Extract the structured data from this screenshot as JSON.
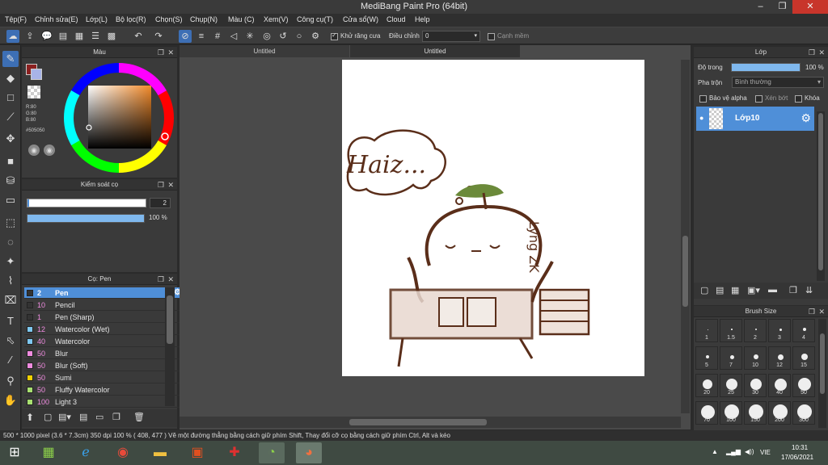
{
  "window": {
    "title": "MediBang Paint Pro (64bit)",
    "minimize": "–",
    "restore": "❐",
    "close": "✕"
  },
  "menu": [
    "Tệp(F)",
    "Chỉnh sửa(E)",
    "Lớp(L)",
    "Bộ lọc(R)",
    "Chọn(S)",
    "Chụp(N)",
    "Màu (C)",
    "Xem(V)",
    "Công cụ(T)",
    "Cửa sổ(W)",
    "Cloud",
    "Help"
  ],
  "toolbar": {
    "antialias_label": "Khử răng cưa",
    "correction_label": "Điều chỉnh",
    "correction_value": "0",
    "edge_label": "Cạnh mềm"
  },
  "color_panel": {
    "title": "Màu",
    "r": "R:80",
    "g": "G:80",
    "b": "B:80",
    "hex": "#505050",
    "accent": "#4f8fd8"
  },
  "brush_control": {
    "title": "Kiểm soát cọ",
    "size_value": "2",
    "opacity_value": "100 %"
  },
  "brush_panel": {
    "title": "Cọ: Pen",
    "items": [
      {
        "num": "2",
        "name": "Pen",
        "color": "#333333",
        "selected": true
      },
      {
        "num": "10",
        "name": "Pencil",
        "color": "#333333",
        "selected": false
      },
      {
        "num": "1",
        "name": "Pen (Sharp)",
        "color": "#333333",
        "selected": false
      },
      {
        "num": "12",
        "name": "Watercolor (Wet)",
        "color": "#7ec8f0",
        "selected": false
      },
      {
        "num": "40",
        "name": "Watercolor",
        "color": "#7ec8f0",
        "selected": false
      },
      {
        "num": "50",
        "name": "Blur",
        "color": "#f08ce0",
        "selected": false
      },
      {
        "num": "50",
        "name": "Blur (Soft)",
        "color": "#f08ce0",
        "selected": false
      },
      {
        "num": "50",
        "name": "Sumi",
        "color": "#f0d000",
        "selected": false
      },
      {
        "num": "50",
        "name": "Fluffy Watercolor",
        "color": "#a8e070",
        "selected": false
      },
      {
        "num": "100",
        "name": "Light 3",
        "color": "#a8e070",
        "selected": false
      }
    ]
  },
  "tabs": [
    "Untitled",
    "Untitled"
  ],
  "layer_panel": {
    "title": "Lớp",
    "opacity_label": "Độ trong",
    "opacity_value": "100 %",
    "blend_label": "Pha trộn",
    "blend_value": "Bình thường",
    "protect_alpha": "Bảo vệ alpha",
    "clipping": "Xén bớt",
    "lock": "Khóa",
    "layer_name": "Lớp10"
  },
  "brush_size_panel": {
    "title": "Brush Size",
    "sizes": [
      "1",
      "1.5",
      "2",
      "3",
      "4",
      "5",
      "7",
      "10",
      "12",
      "15",
      "20",
      "25",
      "30",
      "40",
      "50",
      "70",
      "100",
      "150",
      "200",
      "300"
    ]
  },
  "canvas": {
    "drawing_text": "Haiz...",
    "signature": "Lyng ZK"
  },
  "status": {
    "text": "500 * 1000 pixel   (3.6 * 7.3cm)   350 dpi   100 %   ( 408, 477 )   Vẽ một đường thẳng bằng cách giữ phím Shift, Thay đổi cỡ cọ bằng cách giữ phím Ctrl, Alt và kéo"
  },
  "taskbar": {
    "lang": "VIE",
    "time": "10:31",
    "date": "17/06/2021"
  }
}
